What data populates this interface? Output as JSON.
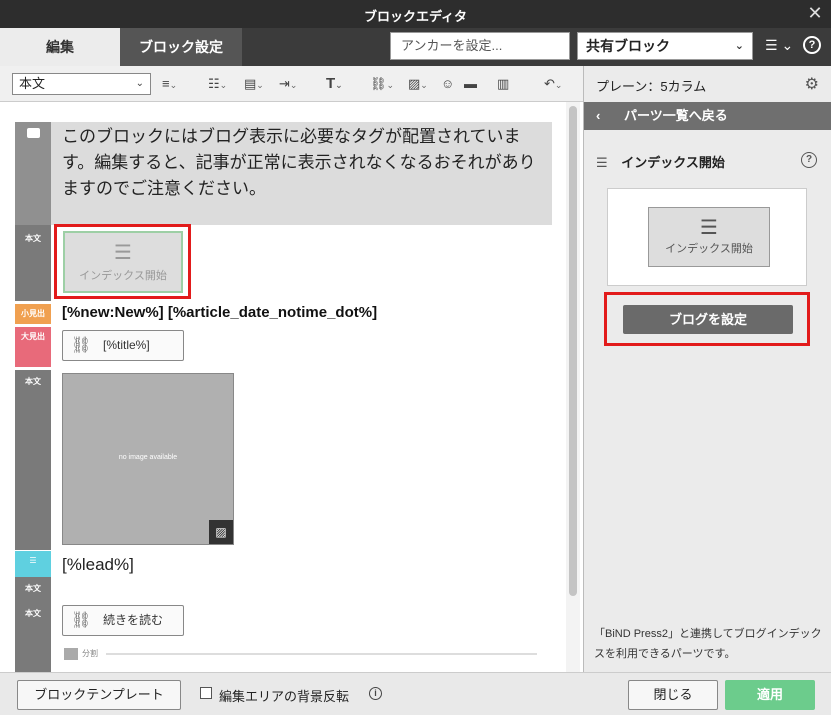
{
  "window": {
    "title": "ブロックエディタ",
    "close": "✕"
  },
  "tabs": [
    {
      "label": "編集"
    },
    {
      "label": "ブロック設定"
    }
  ],
  "header": {
    "anchor_placeholder": "アンカーを設定...",
    "shared_block": "共有ブロック"
  },
  "toolbar": {
    "style_select": "本文"
  },
  "editor": {
    "notice_text": "このブロックにはブログ表示に必要なタグが配置されています。編集すると、記事が正常に表示されなくなるおそれがありますのでご注意ください。",
    "tag_body": "本文",
    "tag_small_heading": "小見出",
    "tag_large_heading": "大見出",
    "index_label": "インデックス開始",
    "meta_line": "[%new:New%] [%article_date_notime_dot%]",
    "title_link": "[%title%]",
    "noimage_text": "no image available",
    "lead": "[%lead%]",
    "readmore_link": "続きを読む",
    "divider_label": "分割"
  },
  "right_panel": {
    "plane": "プレーン：5カラム",
    "back": "パーツ一覧へ戻る",
    "part_name": "インデックス開始",
    "preview_label": "インデックス開始",
    "blog_button": "ブログを設定",
    "footer_text": "「BiND Press2」と連携してブログインデックスを利用できるパーツです。"
  },
  "bottom": {
    "template_button": "ブロックテンプレート",
    "bg_invert_label": "編集エリアの背景反転",
    "close_button": "閉じる",
    "apply_button": "適用"
  },
  "colors": {
    "accent_red": "#e21b1b",
    "apply_green": "#6ccc8c",
    "small_heading_tag": "#f0a050",
    "large_heading_tag": "#e86a7a",
    "lead_tag": "#5fd0e0"
  }
}
